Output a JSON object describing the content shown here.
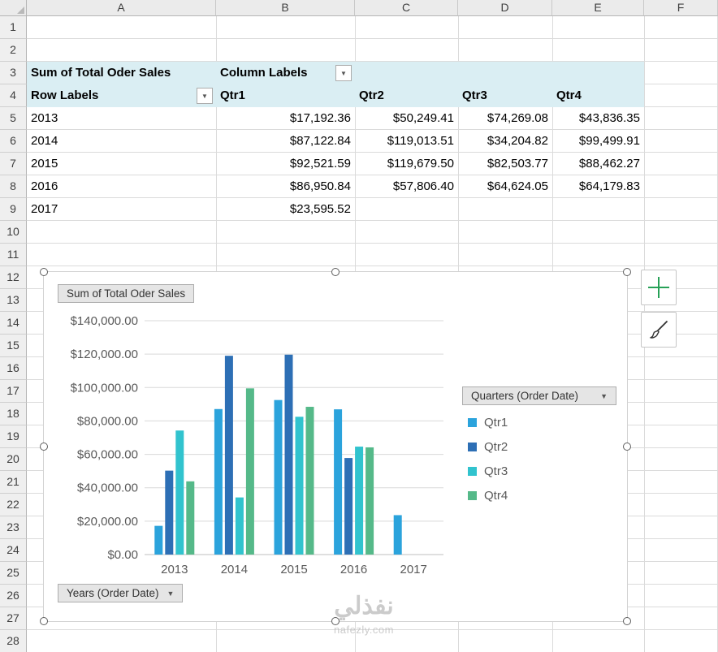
{
  "grid": {
    "column_headers": [
      "A",
      "B",
      "C",
      "D",
      "E",
      "F"
    ],
    "row_headers": [
      "1",
      "2",
      "3",
      "4",
      "5",
      "6",
      "7",
      "8",
      "9",
      "10",
      "11",
      "12",
      "13",
      "14",
      "15",
      "16",
      "17",
      "18",
      "19",
      "20",
      "21",
      "22",
      "23",
      "24",
      "25",
      "26",
      "27",
      "28"
    ]
  },
  "icons": {
    "dropdown": "▼"
  },
  "pivot_table": {
    "title_cell": "Sum of Total Oder Sales",
    "column_labels_cell": "Column Labels",
    "row_labels_cell": "Row Labels",
    "quarter_headers": [
      "Qtr1",
      "Qtr2",
      "Qtr3",
      "Qtr4"
    ],
    "rows": [
      {
        "year": "2013",
        "values": [
          "$17,192.36",
          "$50,249.41",
          "$74,269.08",
          "$43,836.35"
        ]
      },
      {
        "year": "2014",
        "values": [
          "$87,122.84",
          "$119,013.51",
          "$34,204.82",
          "$99,499.91"
        ]
      },
      {
        "year": "2015",
        "values": [
          "$92,521.59",
          "$119,679.50",
          "$82,503.77",
          "$88,462.27"
        ]
      },
      {
        "year": "2016",
        "values": [
          "$86,950.84",
          "$57,806.40",
          "$64,624.05",
          "$64,179.83"
        ]
      },
      {
        "year": "2017",
        "values": [
          "$23,595.52",
          "",
          "",
          ""
        ]
      }
    ]
  },
  "chart": {
    "title_button": "Sum of Total Oder Sales",
    "legend_button": "Quarters (Order Date)",
    "axis_button": "Years (Order Date)"
  },
  "chart_data": {
    "type": "bar",
    "title": "Sum of Total Oder Sales",
    "categories": [
      "2013",
      "2014",
      "2015",
      "2016",
      "2017"
    ],
    "series": [
      {
        "name": "Qtr1",
        "color": "#2BA3DC",
        "values": [
          17192.36,
          87122.84,
          92521.59,
          86950.84,
          23595.52
        ]
      },
      {
        "name": "Qtr2",
        "color": "#2D6FB5",
        "values": [
          50249.41,
          119013.51,
          119679.5,
          57806.4,
          null
        ]
      },
      {
        "name": "Qtr3",
        "color": "#31C3CE",
        "values": [
          74269.08,
          34204.82,
          82503.77,
          64624.05,
          null
        ]
      },
      {
        "name": "Qtr4",
        "color": "#55B989",
        "values": [
          43836.35,
          99499.91,
          88462.27,
          64179.83,
          null
        ]
      }
    ],
    "ylim": [
      0,
      140000
    ],
    "ytick_step": 20000,
    "ytick_labels": [
      "$0.00",
      "$20,000.00",
      "$40,000.00",
      "$60,000.00",
      "$80,000.00",
      "$100,000.00",
      "$120,000.00",
      "$140,000.00"
    ],
    "legend_position": "right",
    "grid": true
  },
  "watermark": {
    "arabic": "نفذلي",
    "domain": "nafezly.com"
  }
}
